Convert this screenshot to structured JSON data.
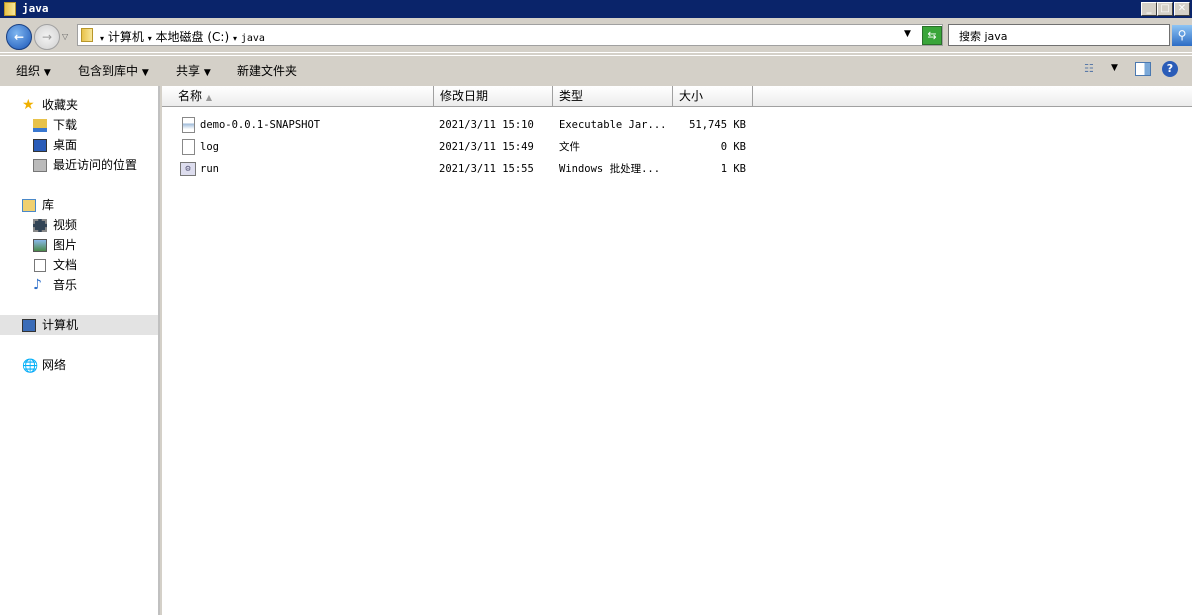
{
  "window": {
    "title": "java"
  },
  "address": {
    "crumbs": [
      "计算机",
      "本地磁盘 (C:)",
      "java"
    ]
  },
  "search": {
    "placeholder": "搜索 java"
  },
  "toolbar": {
    "organize": "组织",
    "include_library": "包含到库中",
    "share": "共享",
    "new_folder": "新建文件夹"
  },
  "sidebar": {
    "favorites": "收藏夹",
    "downloads": "下载",
    "desktop": "桌面",
    "recent": "最近访问的位置",
    "libraries": "库",
    "videos": "视频",
    "pictures": "图片",
    "documents": "文档",
    "music": "音乐",
    "computer": "计算机",
    "network": "网络"
  },
  "columns": {
    "name": "名称",
    "date": "修改日期",
    "type": "类型",
    "size": "大小"
  },
  "files": [
    {
      "name": "demo-0.0.1-SNAPSHOT",
      "date": "2021/3/11 15:10",
      "type": "Executable Jar...",
      "size": "51,745 KB",
      "icon": "jar-file-icon"
    },
    {
      "name": "log",
      "date": "2021/3/11 15:49",
      "type": "文件",
      "size": "0 KB",
      "icon": "blank-file-icon"
    },
    {
      "name": "run",
      "date": "2021/3/11 15:55",
      "type": "Windows 批处理...",
      "size": "1 KB",
      "icon": "batch-file-icon"
    }
  ]
}
